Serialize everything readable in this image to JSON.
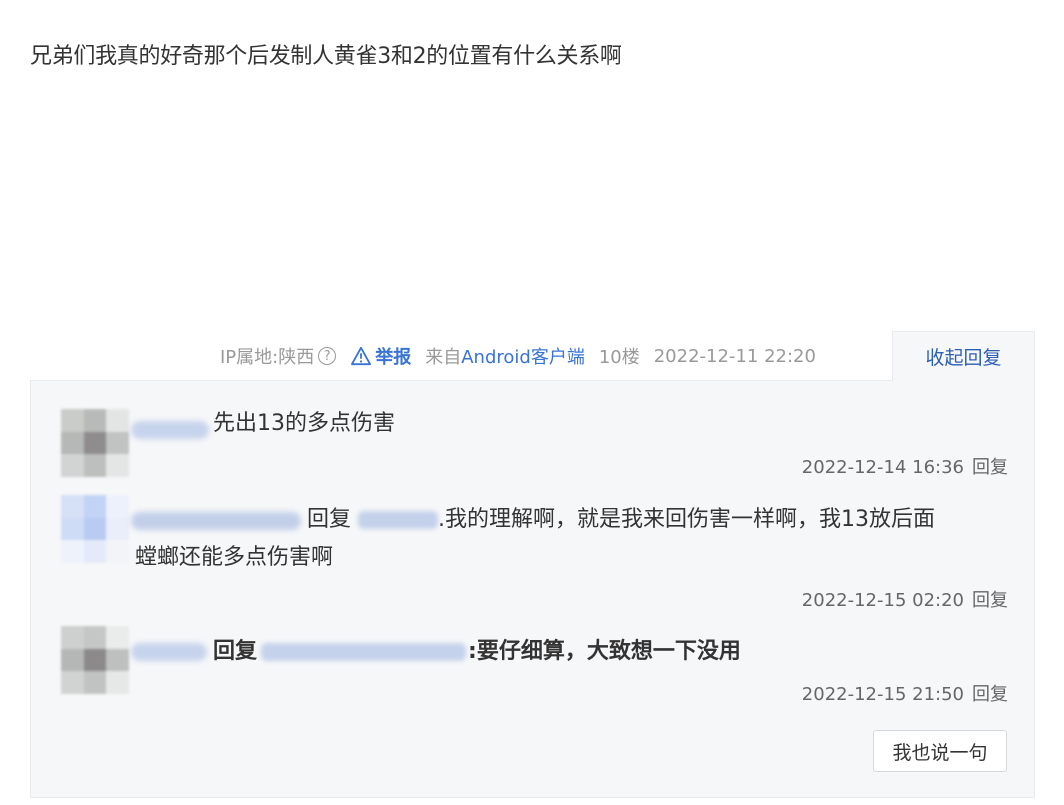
{
  "post": {
    "content": "兄弟们我真的好奇那个后发制人黄雀3和2的位置有什么关系啊"
  },
  "meta": {
    "ip_location": "IP属地:陕西",
    "report_label": "举报",
    "source_prefix": "来自",
    "source_client": "Android客户端",
    "floor": "10楼",
    "datetime": "2022-12-11 22:20",
    "collapse_label": "收起回复"
  },
  "replies": [
    {
      "content": "先出13的多点伤害",
      "datetime": "2022-12-14 16:36",
      "reply_label": "回复"
    },
    {
      "reply_prefix": "回复",
      "content_line1": ".我的理解啊，就是我来回伤害一样啊，我13放后面",
      "content_line2": "螳螂还能多点伤害啊",
      "datetime": "2022-12-15 02:20",
      "reply_label": "回复"
    },
    {
      "reply_prefix": "回复",
      "content": ":要仔细算，大致想一下没用",
      "datetime": "2022-12-15 21:50",
      "reply_label": "回复"
    }
  ],
  "actions": {
    "say_label": "我也说一句"
  },
  "colors": {
    "link_blue": "#3873d6",
    "panel_bg": "#f6f7f9",
    "meta_gray": "#999999"
  }
}
